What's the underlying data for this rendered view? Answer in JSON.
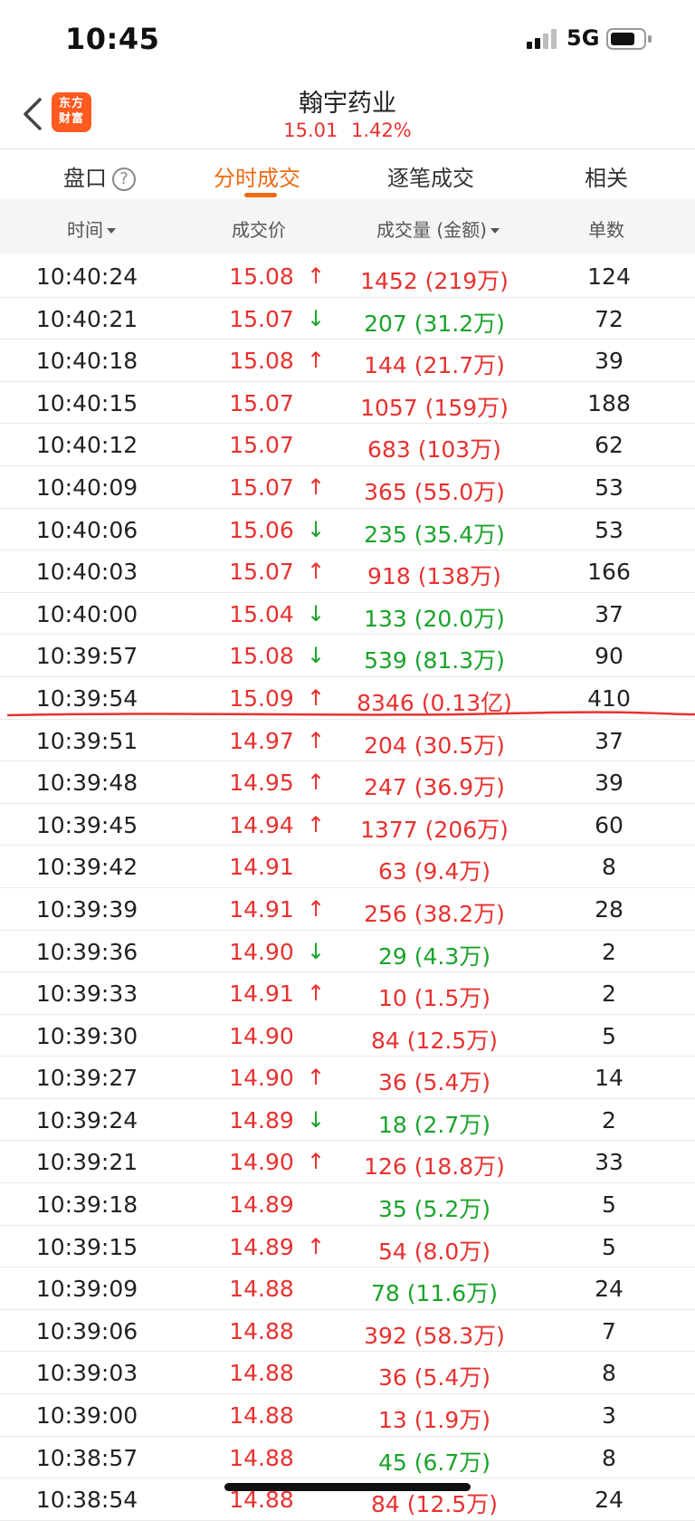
{
  "status": {
    "time": "10:45",
    "network": "5G"
  },
  "header": {
    "logo_text": "东方财富",
    "title": "翰宇药业",
    "price": "15.01",
    "change_pct": "1.42%"
  },
  "tabs": [
    {
      "label": "盘口"
    },
    {
      "label": "分时成交"
    },
    {
      "label": "逐笔成交"
    },
    {
      "label": "相关"
    }
  ],
  "columns": {
    "time": "时间",
    "price": "成交价",
    "volume": "成交量 (金额)",
    "count": "单数"
  },
  "rows": [
    {
      "time": "10:40:24",
      "price": "15.08",
      "dir": "up",
      "volume": "1452 (219万)",
      "count": "124"
    },
    {
      "time": "10:40:21",
      "price": "15.07",
      "dir": "down",
      "volume": "207 (31.2万)",
      "count": "72"
    },
    {
      "time": "10:40:18",
      "price": "15.08",
      "dir": "up",
      "volume": "144 (21.7万)",
      "count": "39"
    },
    {
      "time": "10:40:15",
      "price": "15.07",
      "dir": "none",
      "volume": "1057 (159万)",
      "count": "188",
      "vol_color": "up"
    },
    {
      "time": "10:40:12",
      "price": "15.07",
      "dir": "none",
      "volume": "683 (103万)",
      "count": "62",
      "vol_color": "up"
    },
    {
      "time": "10:40:09",
      "price": "15.07",
      "dir": "up",
      "volume": "365 (55.0万)",
      "count": "53"
    },
    {
      "time": "10:40:06",
      "price": "15.06",
      "dir": "down",
      "volume": "235 (35.4万)",
      "count": "53"
    },
    {
      "time": "10:40:03",
      "price": "15.07",
      "dir": "up",
      "volume": "918 (138万)",
      "count": "166"
    },
    {
      "time": "10:40:00",
      "price": "15.04",
      "dir": "down",
      "volume": "133 (20.0万)",
      "count": "37"
    },
    {
      "time": "10:39:57",
      "price": "15.08",
      "dir": "down",
      "volume": "539 (81.3万)",
      "count": "90"
    },
    {
      "time": "10:39:54",
      "price": "15.09",
      "dir": "up",
      "volume": "8346 (0.13亿)",
      "count": "410"
    },
    {
      "time": "10:39:51",
      "price": "14.97",
      "dir": "up",
      "volume": "204 (30.5万)",
      "count": "37"
    },
    {
      "time": "10:39:48",
      "price": "14.95",
      "dir": "up",
      "volume": "247 (36.9万)",
      "count": "39"
    },
    {
      "time": "10:39:45",
      "price": "14.94",
      "dir": "up",
      "volume": "1377 (206万)",
      "count": "60"
    },
    {
      "time": "10:39:42",
      "price": "14.91",
      "dir": "none",
      "volume": "63 (9.4万)",
      "count": "8",
      "vol_color": "up"
    },
    {
      "time": "10:39:39",
      "price": "14.91",
      "dir": "up",
      "volume": "256 (38.2万)",
      "count": "28"
    },
    {
      "time": "10:39:36",
      "price": "14.90",
      "dir": "down",
      "volume": "29 (4.3万)",
      "count": "2"
    },
    {
      "time": "10:39:33",
      "price": "14.91",
      "dir": "up",
      "volume": "10 (1.5万)",
      "count": "2"
    },
    {
      "time": "10:39:30",
      "price": "14.90",
      "dir": "none",
      "volume": "84 (12.5万)",
      "count": "5",
      "vol_color": "up"
    },
    {
      "time": "10:39:27",
      "price": "14.90",
      "dir": "up",
      "volume": "36 (5.4万)",
      "count": "14"
    },
    {
      "time": "10:39:24",
      "price": "14.89",
      "dir": "down",
      "volume": "18 (2.7万)",
      "count": "2"
    },
    {
      "time": "10:39:21",
      "price": "14.90",
      "dir": "up",
      "volume": "126 (18.8万)",
      "count": "33"
    },
    {
      "time": "10:39:18",
      "price": "14.89",
      "dir": "none",
      "volume": "35 (5.2万)",
      "count": "5",
      "vol_color": "down"
    },
    {
      "time": "10:39:15",
      "price": "14.89",
      "dir": "up",
      "volume": "54 (8.0万)",
      "count": "5"
    },
    {
      "time": "10:39:09",
      "price": "14.88",
      "dir": "none",
      "volume": "78 (11.6万)",
      "count": "24",
      "vol_color": "down"
    },
    {
      "time": "10:39:06",
      "price": "14.88",
      "dir": "none",
      "volume": "392 (58.3万)",
      "count": "7",
      "vol_color": "up"
    },
    {
      "time": "10:39:03",
      "price": "14.88",
      "dir": "none",
      "volume": "36 (5.4万)",
      "count": "8",
      "vol_color": "up"
    },
    {
      "time": "10:39:00",
      "price": "14.88",
      "dir": "none",
      "volume": "13 (1.9万)",
      "count": "3",
      "vol_color": "up"
    },
    {
      "time": "10:38:57",
      "price": "14.88",
      "dir": "none",
      "volume": "45 (6.7万)",
      "count": "8",
      "vol_color": "down"
    },
    {
      "time": "10:38:54",
      "price": "14.88",
      "dir": "none",
      "volume": "84 (12.5万)",
      "count": "24",
      "vol_color": "up"
    }
  ],
  "colors": {
    "up": "#e8312f",
    "down": "#1aa32a",
    "accent": "#ee6a14"
  }
}
